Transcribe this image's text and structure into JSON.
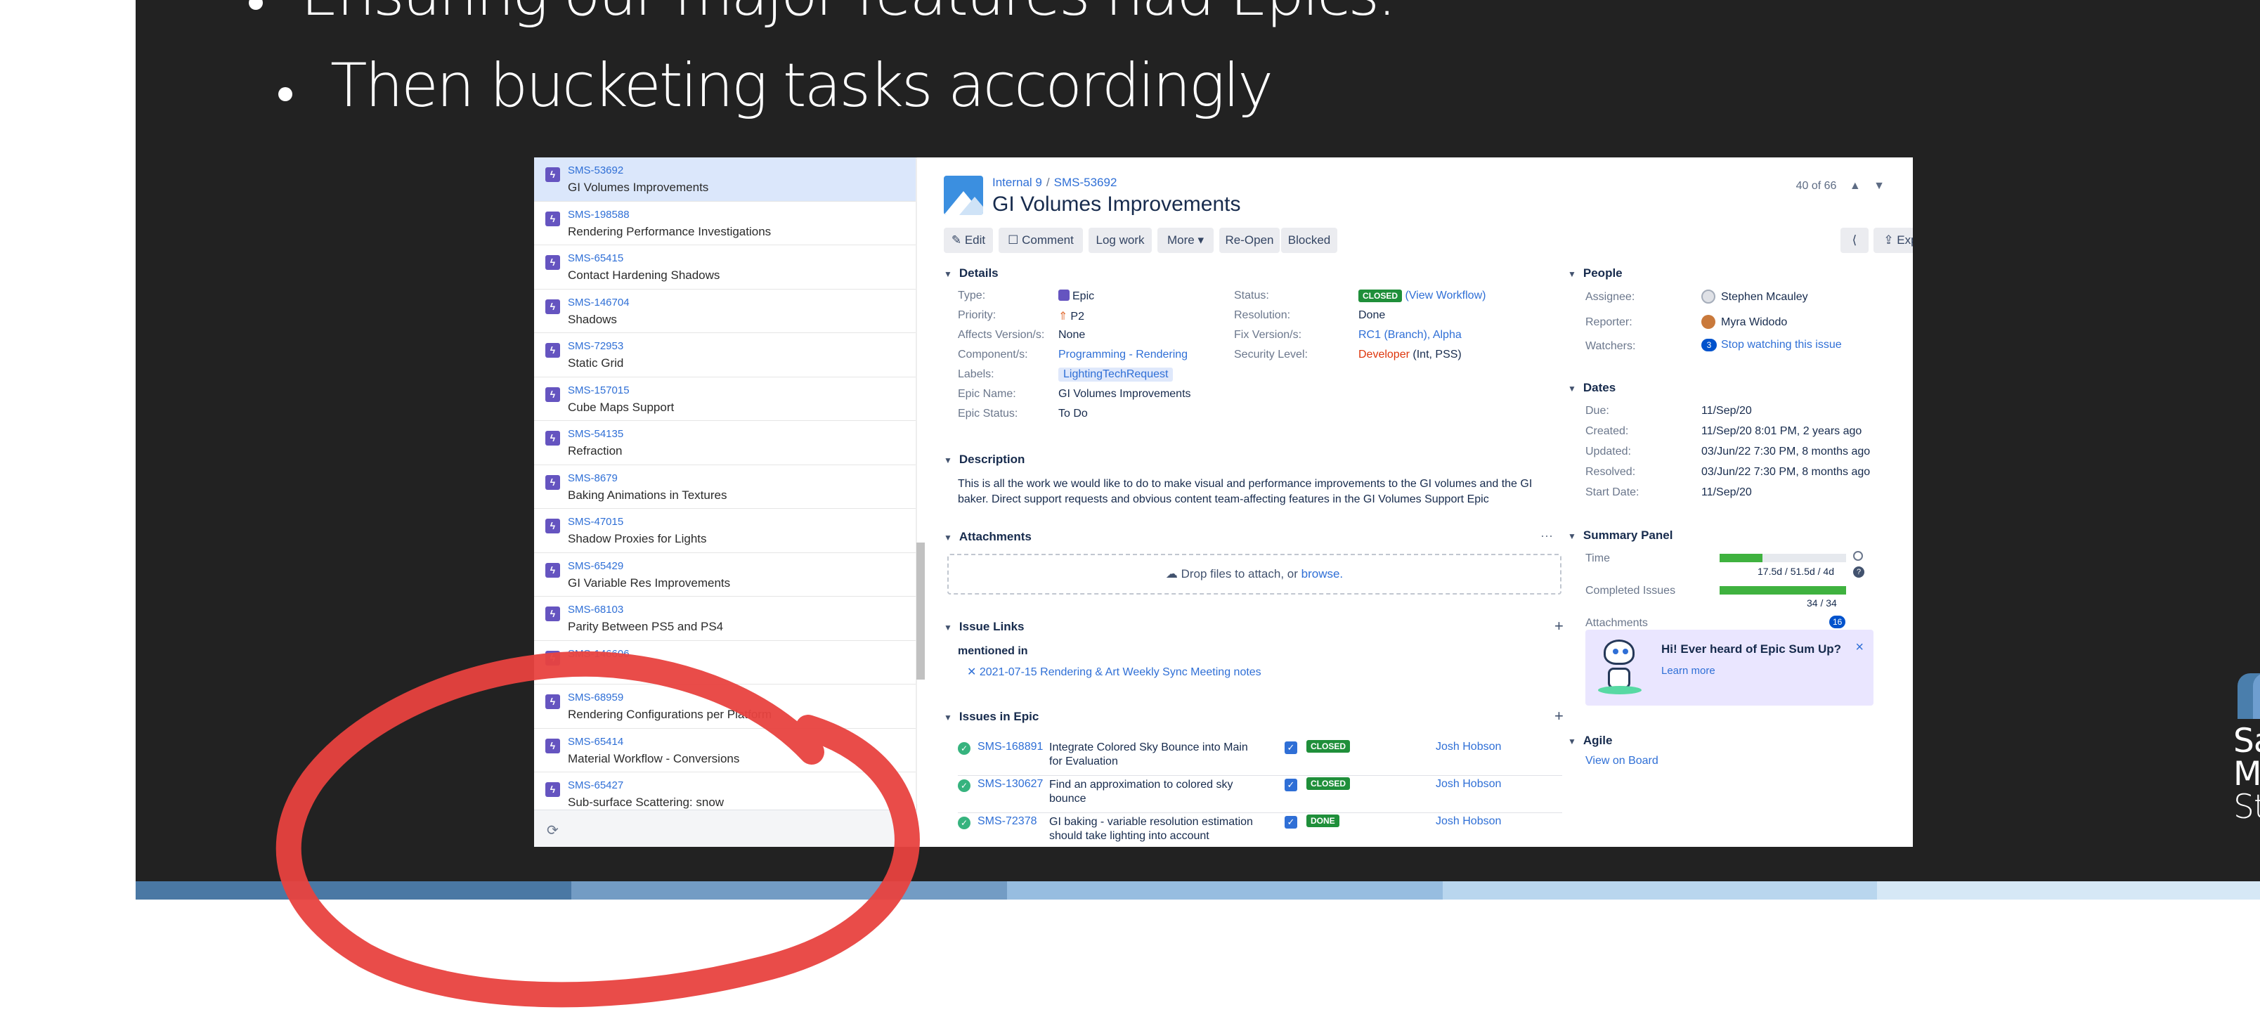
{
  "slide": {
    "bullet1": "Ensuring our major features had Epics.",
    "bullet2": "Then bucketing tasks accordingly"
  },
  "logo": {
    "line1": "Santa",
    "line2": "Monica",
    "line3": "Studio"
  },
  "issue_list": [
    {
      "key": "SMS-53692",
      "summary": "GI Volumes Improvements",
      "selected": true
    },
    {
      "key": "SMS-198588",
      "summary": "Rendering Performance Investigations"
    },
    {
      "key": "SMS-65415",
      "summary": "Contact Hardening Shadows"
    },
    {
      "key": "SMS-146704",
      "summary": "Shadows"
    },
    {
      "key": "SMS-72953",
      "summary": "Static Grid"
    },
    {
      "key": "SMS-157015",
      "summary": "Cube Maps Support"
    },
    {
      "key": "SMS-54135",
      "summary": "Refraction"
    },
    {
      "key": "SMS-8679",
      "summary": "Baking Animations in Textures"
    },
    {
      "key": "SMS-47015",
      "summary": "Shadow Proxies for Lights"
    },
    {
      "key": "SMS-65429",
      "summary": "GI Variable Res Improvements"
    },
    {
      "key": "SMS-68103",
      "summary": "Parity Between PS5 and PS4"
    },
    {
      "key": "SMS-146606",
      "summary": ""
    },
    {
      "key": "SMS-68959",
      "summary": "Rendering Configurations per Platform"
    },
    {
      "key": "SMS-65414",
      "summary": "Material Workflow - Conversions"
    },
    {
      "key": "SMS-65427",
      "summary": "Sub-surface Scattering: snow"
    }
  ],
  "issue": {
    "crumb_project": "Internal 9",
    "crumb_sep": "/",
    "crumb_key": "SMS-53692",
    "title": "GI Volumes Improvements",
    "pager": "40 of 66",
    "pager_up": "▲",
    "pager_down": "▼"
  },
  "toolbar": {
    "edit": "✎ Edit",
    "comment": "☐ Comment",
    "log_work": "Log work",
    "more": "More ▾",
    "reopen": "Re-Open",
    "blocked": "Blocked",
    "share": "⟨",
    "export": "⇪ Export ▾"
  },
  "details": {
    "heading": "Details",
    "type_label": "Type:",
    "type_value": "Epic",
    "priority_label": "Priority:",
    "priority_value": "P2",
    "affects_label": "Affects Version/s:",
    "affects_value": "None",
    "component_label": "Component/s:",
    "component_value": "Programming - Rendering",
    "labels_label": "Labels:",
    "labels_value": "LightingTechRequest",
    "epic_name_label": "Epic Name:",
    "epic_name_value": "GI Volumes Improvements",
    "epic_status_label": "Epic Status:",
    "epic_status_value": "To Do",
    "status_label": "Status:",
    "status_value": "CLOSED",
    "status_link": "(View Workflow)",
    "resolution_label": "Resolution:",
    "resolution_value": "Done",
    "fix_label": "Fix Version/s:",
    "fix_value": "RC1 (Branch), Alpha",
    "security_label": "Security Level:",
    "security_value": "Developer",
    "security_suffix": "(Int, PSS)"
  },
  "description": {
    "heading": "Description",
    "text": "This is all the work we would like to do to make visual and performance improvements to the GI volumes and the GI baker. Direct support requests and obvious content team-affecting features in the GI Volumes Support Epic"
  },
  "attachments": {
    "heading": "Attachments",
    "drop_text": "Drop files to attach, or",
    "browse": "browse.",
    "more": "···"
  },
  "issue_links": {
    "heading": "Issue Links",
    "relation": "mentioned in",
    "link": "2021-07-15 Rendering & Art Weekly Sync Meeting notes",
    "add": "+"
  },
  "issues_in_epic": {
    "heading": "Issues in Epic",
    "add": "+",
    "rows": [
      {
        "key": "SMS-168891",
        "summary": "Integrate Colored Sky Bounce into Main for Evaluation",
        "status": "CLOSED",
        "assignee": "Josh Hobson"
      },
      {
        "key": "SMS-130627",
        "summary": "Find an approximation to colored sky bounce",
        "status": "CLOSED",
        "assignee": "Josh Hobson"
      },
      {
        "key": "SMS-72378",
        "summary": "GI baking - variable resolution estimation should take lighting into account",
        "status": "DONE",
        "assignee": "Josh Hobson"
      }
    ]
  },
  "people": {
    "heading": "People",
    "assignee_label": "Assignee:",
    "assignee": "Stephen Mcauley",
    "reporter_label": "Reporter:",
    "reporter": "Myra Widodo",
    "watchers_label": "Watchers:",
    "watchers_count": "3",
    "watchers_link": "Stop watching this issue"
  },
  "dates": {
    "heading": "Dates",
    "due_label": "Due:",
    "due": "11/Sep/20",
    "created_label": "Created:",
    "created": "11/Sep/20 8:01 PM, 2 years ago",
    "updated_label": "Updated:",
    "updated": "03/Jun/22 7:30 PM, 8 months ago",
    "resolved_label": "Resolved:",
    "resolved": "03/Jun/22 7:30 PM, 8 months ago",
    "start_label": "Start Date:",
    "start": "11/Sep/20"
  },
  "summary_panel": {
    "heading": "Summary Panel",
    "time_label": "Time",
    "time_value": "17.5d / 51.5d / 4d",
    "time_fraction": 0.34,
    "completed_label": "Completed Issues",
    "completed_value": "34 / 34",
    "completed_fraction": 1.0,
    "attachments_label": "Attachments",
    "attachments_count": "16"
  },
  "promo": {
    "title": "Hi! Ever heard of Epic Sum Up?",
    "link": "Learn more",
    "close": "×"
  },
  "agile": {
    "heading": "Agile",
    "link": "View on Board"
  },
  "colors": {
    "slide_bg": "#222222",
    "accent_link": "#2f6fd6",
    "epic_purple": "#6554c0",
    "closed_green": "#1f8f3a",
    "annotation_red": "#e8423f",
    "stripe": [
      "#4a78a4",
      "#739cc4",
      "#97bde0",
      "#b9d6ee",
      "#d6e8f6"
    ]
  }
}
